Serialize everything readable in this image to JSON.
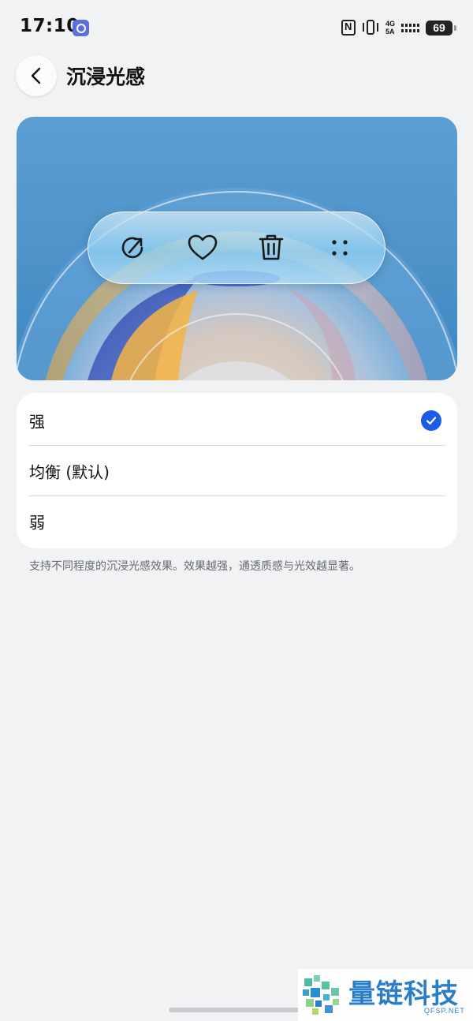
{
  "status_bar": {
    "time": "17:10",
    "network_top": "4G",
    "network_bottom": "5A",
    "battery": "69"
  },
  "header": {
    "title": "沉浸光感"
  },
  "preview": {
    "toolbar_icons": [
      "share-icon",
      "heart-icon",
      "trash-icon",
      "more-icon"
    ]
  },
  "options": [
    {
      "label": "强",
      "selected": true
    },
    {
      "label": "均衡 (默认)",
      "selected": false
    },
    {
      "label": "弱",
      "selected": false
    }
  ],
  "description": "支持不同程度的沉浸光感效果。效果越强，通透质感与光效越显著。",
  "watermark": {
    "text": "量链科技",
    "url": "QFSP.NET"
  },
  "colors": {
    "accent": "#1d5ce8",
    "background": "#f1f2f4"
  }
}
